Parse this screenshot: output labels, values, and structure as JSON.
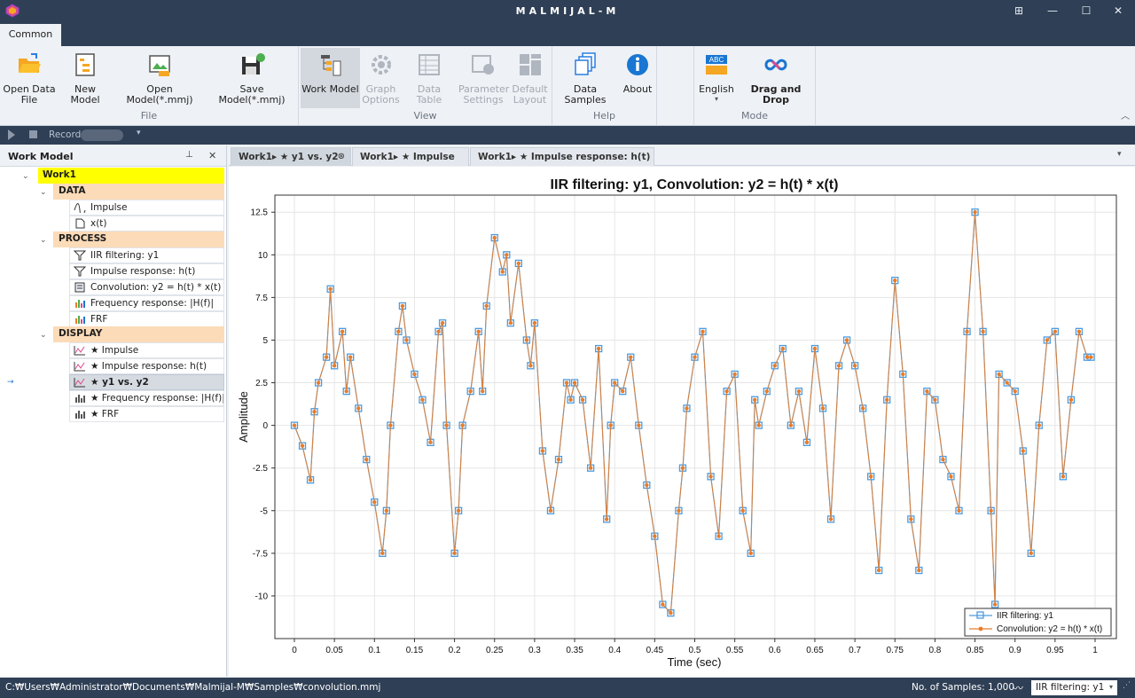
{
  "app": {
    "title": "MALMIJAL-M"
  },
  "ribbon": {
    "tab": "Common",
    "groups": [
      {
        "label": "File",
        "buttons": [
          {
            "label": "Open Data\nFile",
            "icon": "open-folder-icon"
          },
          {
            "label": "New Model",
            "icon": "new-model-icon"
          },
          {
            "label": "Open Model(*.mmj)",
            "icon": "open-model-icon"
          },
          {
            "label": "Save Model(*.mmj)",
            "icon": "save-model-icon"
          }
        ]
      },
      {
        "label": "View",
        "buttons": [
          {
            "label": "Work Model",
            "icon": "work-model-icon"
          },
          {
            "label": "Graph\nOptions",
            "icon": "gear-icon"
          },
          {
            "label": "Data Table",
            "icon": "table-icon"
          },
          {
            "label": "Parameter\nSettings",
            "icon": "settings-icon"
          },
          {
            "label": "Default\nLayout",
            "icon": "layout-icon"
          }
        ]
      },
      {
        "label": "Help",
        "buttons": [
          {
            "label": "Data Samples",
            "icon": "samples-icon"
          },
          {
            "label": "About",
            "icon": "info-icon"
          }
        ]
      },
      {
        "label": "Mode",
        "buttons": [
          {
            "label": "English",
            "icon": "language-icon"
          },
          {
            "label": "Drag and Drop",
            "icon": "infinity-icon"
          }
        ]
      }
    ]
  },
  "toolbar": {
    "record_label": "Record"
  },
  "work_model": {
    "title": "Work Model",
    "root": "Work1",
    "sections": [
      {
        "label": "DATA",
        "items": [
          "Impulse",
          "x(t)"
        ]
      },
      {
        "label": "PROCESS",
        "items": [
          "IIR filtering: y1",
          "Impulse response: h(t)",
          "Convolution: y2 = h(t) * x(t)",
          "Frequency response: |H(f)|",
          "FRF"
        ]
      },
      {
        "label": "DISPLAY",
        "items": [
          "★ Impulse",
          "★ Impulse response: h(t)",
          "★ y1 vs. y2",
          "★ Frequency response: |H(f)|",
          "★ FRF"
        ]
      }
    ],
    "selected": "★ y1 vs. y2"
  },
  "doc_tabs": [
    {
      "label": "Work1▸ ★ y1 vs. y2",
      "active": true
    },
    {
      "label": "Work1▸ ★ Impulse",
      "active": false
    },
    {
      "label": "Work1▸ ★ Impulse response: h(t)",
      "active": false
    }
  ],
  "status": {
    "path": "C:₩Users₩Administrator₩Documents₩Malmijal-M₩Samples₩convolution.mmj",
    "samples": "No. of Samples: 1,000",
    "series_select": "IIR filtering: y1"
  },
  "chart_data": {
    "type": "line",
    "title": "IIR filtering: y1, Convolution: y2 = h(t) * x(t)",
    "xlabel": "Time (sec)",
    "ylabel": "Amplitude",
    "xlim": [
      0,
      1
    ],
    "ylim": [
      -12.5,
      13.5
    ],
    "xticks": [
      0,
      0.05,
      0.1,
      0.15,
      0.2,
      0.25,
      0.3,
      0.35,
      0.4,
      0.45,
      0.5,
      0.55,
      0.6,
      0.65,
      0.7,
      0.75,
      0.8,
      0.85,
      0.9,
      0.95,
      1
    ],
    "xticklabels": [
      "0",
      "0.05",
      "0.1",
      "0.15",
      "0.2",
      "0.25",
      "0.3",
      "0.35",
      "0.4",
      "0.45",
      "0.5",
      "0.55",
      "0.6",
      "0.65",
      "0.7",
      "0.75",
      "0.8",
      "0.85",
      "0.9",
      "0.95",
      "1"
    ],
    "yticks": [
      12.5,
      10,
      7.5,
      5,
      2.5,
      0,
      -2.5,
      -5,
      -7.5,
      -10
    ],
    "yticklabels": [
      "12.5",
      "10",
      "7.5",
      "5",
      "2.5",
      "0",
      "-2.5",
      "-5",
      "-7.5",
      "-10"
    ],
    "grid": true,
    "legend_position": "bottom-right",
    "x": [
      0,
      0.01,
      0.02,
      0.025,
      0.03,
      0.04,
      0.045,
      0.05,
      0.06,
      0.065,
      0.07,
      0.08,
      0.09,
      0.1,
      0.11,
      0.115,
      0.12,
      0.13,
      0.135,
      0.14,
      0.15,
      0.16,
      0.17,
      0.18,
      0.185,
      0.19,
      0.2,
      0.205,
      0.21,
      0.22,
      0.23,
      0.235,
      0.24,
      0.25,
      0.26,
      0.265,
      0.27,
      0.28,
      0.29,
      0.295,
      0.3,
      0.31,
      0.32,
      0.33,
      0.34,
      0.345,
      0.35,
      0.36,
      0.37,
      0.38,
      0.39,
      0.395,
      0.4,
      0.41,
      0.42,
      0.43,
      0.44,
      0.45,
      0.46,
      0.47,
      0.48,
      0.485,
      0.49,
      0.5,
      0.51,
      0.52,
      0.53,
      0.54,
      0.55,
      0.56,
      0.57,
      0.575,
      0.58,
      0.59,
      0.6,
      0.61,
      0.62,
      0.63,
      0.64,
      0.65,
      0.66,
      0.67,
      0.68,
      0.69,
      0.7,
      0.71,
      0.72,
      0.73,
      0.74,
      0.75,
      0.76,
      0.77,
      0.78,
      0.79,
      0.8,
      0.81,
      0.82,
      0.83,
      0.84,
      0.85,
      0.86,
      0.87,
      0.875,
      0.88,
      0.89,
      0.9,
      0.91,
      0.92,
      0.93,
      0.94,
      0.95,
      0.96,
      0.97,
      0.98,
      0.99,
      0.995
    ],
    "series": [
      {
        "name": "IIR filtering: y1",
        "color": "#4d9ce0",
        "marker": "square",
        "values": [
          0,
          -1.2,
          -3.2,
          0.8,
          2.5,
          4,
          8,
          3.5,
          5.5,
          2,
          4,
          1,
          -2,
          -4.5,
          -7.5,
          -5,
          0,
          5.5,
          7,
          5,
          3,
          1.5,
          -1,
          5.5,
          6,
          0,
          -7.5,
          -5,
          0,
          2,
          5.5,
          2,
          7,
          11,
          9,
          10,
          6,
          9.5,
          5,
          3.5,
          6,
          -1.5,
          -5,
          -2,
          2.5,
          1.5,
          2.5,
          1.5,
          -2.5,
          4.5,
          -5.5,
          0,
          2.5,
          2,
          4,
          0,
          -3.5,
          -6.5,
          -10.5,
          -11,
          -5,
          -2.5,
          1,
          4,
          5.5,
          -3,
          -6.5,
          2,
          3,
          -5,
          -7.5,
          1.5,
          0,
          2,
          3.5,
          4.5,
          0,
          2,
          -1,
          4.5,
          1,
          -5.5,
          3.5,
          5,
          3.5,
          1,
          -3,
          -8.5,
          1.5,
          8.5,
          3,
          -5.5,
          -8.5,
          2,
          1.5,
          -2,
          -3,
          -5,
          5.5,
          12.5,
          5.5,
          -5,
          -10.5,
          3,
          2.5,
          2,
          -1.5,
          -7.5,
          0,
          5,
          5.5,
          -3,
          1.5,
          5.5,
          4,
          4
        ]
      },
      {
        "name": "Convolution: y2 = h(t) * x(t)",
        "color": "#e87d2a",
        "marker": "circle",
        "values": [
          0,
          -1.2,
          -3.2,
          0.8,
          2.5,
          4,
          8,
          3.5,
          5.5,
          2,
          4,
          1,
          -2,
          -4.5,
          -7.5,
          -5,
          0,
          5.5,
          7,
          5,
          3,
          1.5,
          -1,
          5.5,
          6,
          0,
          -7.5,
          -5,
          0,
          2,
          5.5,
          2,
          7,
          11,
          9,
          10,
          6,
          9.5,
          5,
          3.5,
          6,
          -1.5,
          -5,
          -2,
          2.5,
          1.5,
          2.5,
          1.5,
          -2.5,
          4.5,
          -5.5,
          0,
          2.5,
          2,
          4,
          0,
          -3.5,
          -6.5,
          -10.5,
          -11,
          -5,
          -2.5,
          1,
          4,
          5.5,
          -3,
          -6.5,
          2,
          3,
          -5,
          -7.5,
          1.5,
          0,
          2,
          3.5,
          4.5,
          0,
          2,
          -1,
          4.5,
          1,
          -5.5,
          3.5,
          5,
          3.5,
          1,
          -3,
          -8.5,
          1.5,
          8.5,
          3,
          -5.5,
          -8.5,
          2,
          1.5,
          -2,
          -3,
          -5,
          5.5,
          12.5,
          5.5,
          -5,
          -10.5,
          3,
          2.5,
          2,
          -1.5,
          -7.5,
          0,
          5,
          5.5,
          -3,
          1.5,
          5.5,
          4,
          4
        ]
      }
    ]
  }
}
